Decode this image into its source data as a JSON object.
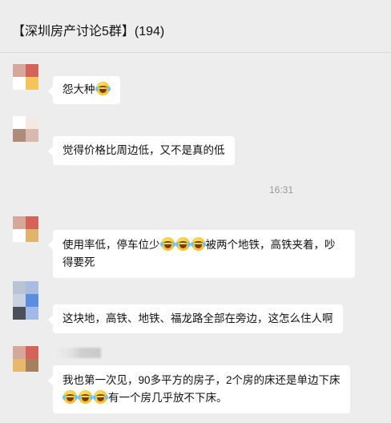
{
  "window": {
    "title": "【深圳房产讨论5群】(194)"
  },
  "messages": [
    {
      "avatar_colors": [
        "#d6a89b",
        "#d4645a",
        "#ffffff",
        "#f5c55a"
      ],
      "text_parts": [
        {
          "t": "text",
          "v": "怨大种"
        },
        {
          "t": "emoji",
          "v": "grin-tears-emoji"
        }
      ]
    },
    {
      "avatar_colors": [
        "#ffffff",
        "#f3e8e2",
        "#b08a7a",
        "#d9b9ad"
      ],
      "text_parts": [
        {
          "t": "text",
          "v": "觉得价格比周边低，又不是真的低"
        }
      ]
    },
    {
      "avatar_colors": [
        "#d6a89b",
        "#d4645a",
        "#ffffff",
        "#e0b46a"
      ],
      "text_parts": [
        {
          "t": "text",
          "v": "使用率低，停车位少"
        },
        {
          "t": "emoji",
          "v": "grin-tears-emoji"
        },
        {
          "t": "emoji",
          "v": "grin-tears-emoji"
        },
        {
          "t": "emoji",
          "v": "grin-tears-emoji"
        },
        {
          "t": "text",
          "v": "被两个地铁，高铁夹着，吵得要死"
        }
      ]
    },
    {
      "avatar_colors": [
        "#b9c3d6",
        "#a8bde0",
        "#c9d2e0",
        "#5a8fe0",
        "#4a4f5a",
        "#9fb9e8"
      ],
      "text_parts": [
        {
          "t": "text",
          "v": "这块地，高铁、地铁、福龙路全部在旁边，这怎么住人啊"
        }
      ]
    },
    {
      "avatar_colors": [
        "#d6a89b",
        "#d4645a",
        "#e8b96a",
        "#a88060"
      ],
      "text_parts": [
        {
          "t": "text",
          "v": "我也第一次见，90多平方的房子，2个房的床还是单边下床"
        },
        {
          "t": "emoji",
          "v": "grin-tears-emoji"
        },
        {
          "t": "emoji",
          "v": "grin-tears-emoji"
        },
        {
          "t": "emoji",
          "v": "grin-tears-emoji"
        },
        {
          "t": "text",
          "v": "有一个房几乎放不下床。"
        }
      ]
    }
  ],
  "timestamp": "16:31",
  "colors": {
    "background": "#ededed",
    "bubble": "#ffffff",
    "timestamp": "#999999"
  }
}
